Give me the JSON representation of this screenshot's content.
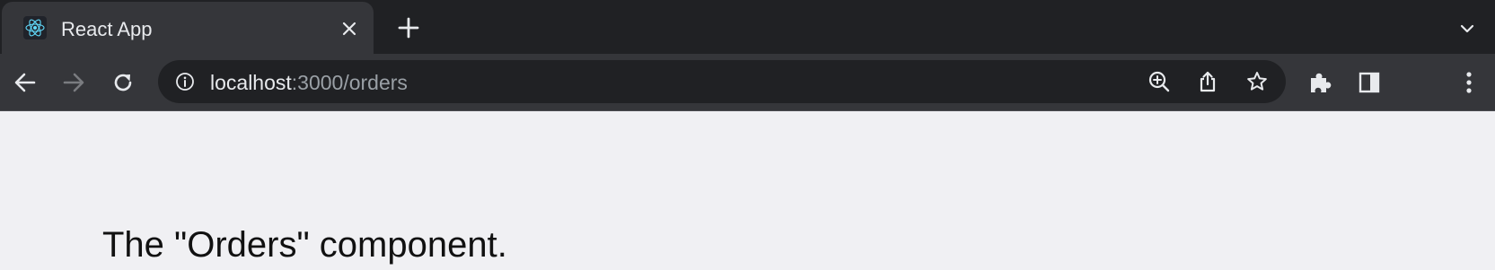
{
  "browser": {
    "tab": {
      "title": "React App",
      "favicon": "react-logo-icon"
    },
    "toolbar": {
      "url_host": "localhost",
      "url_rest": ":3000/orders"
    },
    "icons": {
      "back": "arrow-left-icon",
      "forward": "arrow-right-icon",
      "reload": "reload-icon",
      "site_info": "info-icon",
      "zoom": "zoom-in-icon",
      "share": "share-icon",
      "bookmark": "star-icon",
      "extensions": "puzzle-icon",
      "side_panel": "side-panel-icon",
      "menu": "kebab-menu-icon",
      "new_tab": "plus-icon",
      "tab_search": "chevron-down-icon",
      "close_tab": "close-icon"
    },
    "colors": {
      "tabstrip": "#202124",
      "toolbar": "#35363a",
      "omnibox": "#202124",
      "page_background": "#f0f0f3",
      "react_blue": "#61dafb"
    }
  },
  "page": {
    "heading": "The \"Orders\" component."
  }
}
